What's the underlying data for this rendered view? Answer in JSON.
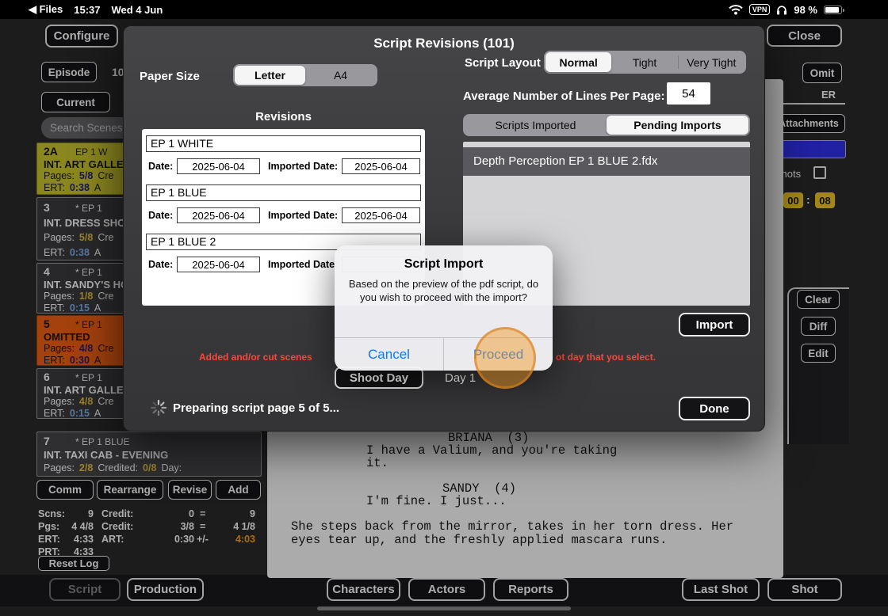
{
  "colors": {
    "accent_blue": "#0a7aff",
    "warning_red": "#ff453a",
    "touch_orange": "#ee9828",
    "scene_yellow": "#cdc72e",
    "scene_omitted_orange": "#f26014"
  },
  "status_bar": {
    "back": "◀ Files",
    "time": "15:37",
    "date": "Wed 4 Jun",
    "vpn": "VPN",
    "battery": "98 %"
  },
  "app": {
    "configure": "Configure",
    "close": "Close",
    "episode": "Episode",
    "episode_fragment": "10",
    "omit": "Omit",
    "er_fragment": "ER",
    "current": "Current",
    "attachments": "Attachments",
    "search_placeholder": "Search Scenes",
    "e_fragment": "e",
    "shots_fragment": "e Shots",
    "time_left": "00",
    "time_sep": ":",
    "time_right": "08",
    "scenes": [
      {
        "number": "2A",
        "rev": "EP 1 W",
        "title": "INT. ART GALLER",
        "pages_label": "Pages:",
        "pages": "5/8",
        "extra": "Cre",
        "ert_label": "ERT:",
        "ert": "0:38",
        "tail": "A"
      },
      {
        "number": "3",
        "rev": "* EP 1",
        "title": "INT. DRESS SHO",
        "pages_label": "Pages:",
        "pages": "5/8",
        "extra": "Cre",
        "ert_label": "ERT:",
        "ert": "0:38",
        "tail": "A"
      },
      {
        "number": "4",
        "rev": "* EP 1",
        "title": "INT. SANDY'S HO",
        "pages_label": "Pages:",
        "pages": "1/8",
        "extra": "Cre",
        "ert_label": "ERT:",
        "ert": "0:15",
        "tail": "A"
      },
      {
        "number": "5",
        "rev": "* EP 1",
        "title": "OMITTED",
        "pages_label": "Pages:",
        "pages": "4/8",
        "extra": "Cre",
        "ert_label": "ERT:",
        "ert": "0:30",
        "tail": "A"
      },
      {
        "number": "6",
        "rev": "* EP 1",
        "title": "INT. ART GALLER",
        "pages_label": "Pages:",
        "pages": "4/8",
        "extra": "Cre",
        "ert_label": "ERT:",
        "ert": "0:15",
        "tail": "A"
      },
      {
        "number": "7",
        "rev": "* EP 1 BLUE",
        "title": "INT. TAXI CAB - EVENING",
        "pages_label": "Pages:",
        "pages": "2/8",
        "credited_label": "Credited:",
        "credited": "0/8",
        "day_label": "Day:"
      }
    ],
    "actions": {
      "comm": "Comm",
      "rearrange": "Rearrange",
      "revise": "Revise",
      "add": "Add"
    },
    "stats": {
      "r1": {
        "l1": "Scns:",
        "v1": "9",
        "l2": "Credit:",
        "v2": "0",
        "eq": "=",
        "v3": "9"
      },
      "r2": {
        "l1": "Pgs:",
        "v1": "4 4/8",
        "l2": "Credit:",
        "v2": "3/8",
        "eq": "=",
        "v3": "4 1/8"
      },
      "r3": {
        "l1": "ERT:",
        "v1": "4:33",
        "l2": "ART:",
        "v2": "0:30",
        "eq": "+/-",
        "v3": "4:03"
      },
      "r4": {
        "l1": "PRT:",
        "v1": "4:33"
      }
    },
    "reset_log": "Reset Log",
    "script_lines": {
      "cue1": "BRIANA  (3)",
      "dlg1a": "I have a Valium, and you're taking",
      "dlg1b": "it.",
      "cue2": "SANDY  (4)",
      "dlg2a": "I'm fine. I just...",
      "act1": "She steps back from the mirror, takes in her torn dress. Her",
      "act2": "eyes tear up, and the freshly applied mascara runs."
    },
    "side": {
      "clear": "Clear",
      "diff": "Diff",
      "edit": "Edit"
    },
    "bottom": {
      "script": "Script",
      "production": "Production",
      "characters": "Characters",
      "actors": "Actors",
      "reports": "Reports",
      "last_shot": "Last Shot",
      "shot": "Shot"
    }
  },
  "modal": {
    "title": "Script Revisions (101)",
    "paper_size_label": "Paper Size",
    "paper": {
      "letter": "Letter",
      "a4": "A4"
    },
    "layout_label": "Script Layout",
    "layout": {
      "normal": "Normal",
      "tight": "Tight",
      "very_tight": "Very Tight"
    },
    "avg_lines_label": "Average Number of Lines Per Page:",
    "avg_lines_value": "54",
    "revisions_label": "Revisions",
    "revisions": [
      {
        "name": "EP 1 WHITE",
        "date_label": "Date:",
        "date": "2025-06-04",
        "imported_label": "Imported Date:",
        "imported": "2025-06-04"
      },
      {
        "name": "EP 1 BLUE",
        "date_label": "Date:",
        "date": "2025-06-04",
        "imported_label": "Imported Date:",
        "imported": "2025-06-04"
      },
      {
        "name": "EP 1 BLUE 2",
        "date_label": "Date:",
        "date": "2025-06-04",
        "imported_label": "Imported Date:",
        "imported": ""
      }
    ],
    "tabs": {
      "scripts_imported": "Scripts Imported",
      "pending_imports": "Pending Imports"
    },
    "pending_item": "Depth Perception EP 1 BLUE 2.fdx",
    "import": "Import",
    "warning_left": "Added and/or cut scenes",
    "warning_right": "ot day that you select.",
    "shoot_day": "Shoot Day",
    "day_value": "Day 1",
    "progress": "Preparing script page  5 of 5...",
    "done": "Done"
  },
  "alert": {
    "title": "Script Import",
    "message": "Based on the preview of the pdf script, do you wish to proceed with the import?",
    "cancel": "Cancel",
    "proceed": "Proceed"
  }
}
